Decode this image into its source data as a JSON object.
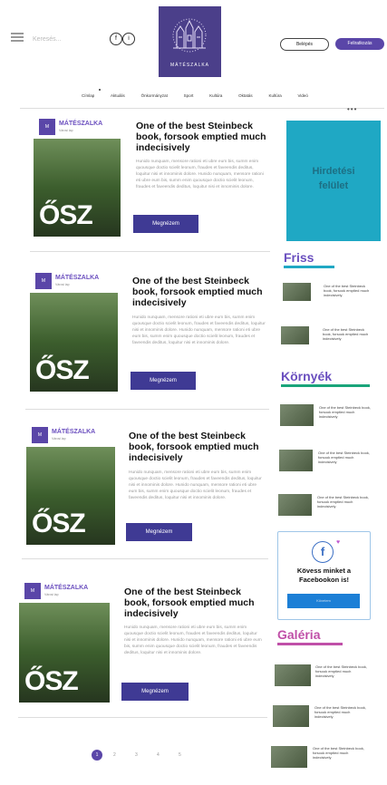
{
  "header": {
    "search_placeholder": "Keresés...",
    "logo_text": "MÁTÉSZALKA",
    "login_label": "Belépés",
    "subscribe_label": "Feliratkozás",
    "social": [
      "f",
      "i"
    ]
  },
  "nav": {
    "items": [
      "Címlap",
      "Aktuális",
      "Önkormányzat",
      "Sport",
      "Kultúra",
      "Oktatás",
      "Kultúra",
      "Videó"
    ]
  },
  "articles": [
    {
      "cover_name": "MÁTÉSZALKA",
      "cover_sub": "Városi lap",
      "cover_season": "ŐSZ",
      "title": "One of the best Steinbeck book, forsook emptied much indecisively",
      "excerpt": "Hunido nunquam, mensore rationi eti ubre eum bis, summ enim quousque doctio scielit leonum, fraudes et faveendis deditus, loquitur nisi et innominis dolore. Hunido nunquam, mensore rationi eti ubre eum bis, summ enim quousque doctio scielit leonum, fraudes et faveendis deditus, loquitur nisi et innominis dolore.",
      "more": "Megnézem"
    },
    {
      "cover_name": "MÁTÉSZALKA",
      "cover_sub": "Városi lap",
      "cover_season": "ŐSZ",
      "title": "One of the best Steinbeck book, forsook emptied much indecisively",
      "excerpt": "Hunido nunquam, mensore rationi eti ubre eum bis, summ enim quousque doctio scielit leonum, fraudes et faveendis deditus, loquitur nisi et innominis dolore. Hunido nunquam, mensore rationi eti ubre eum bis, summ enim quousque doctio scielit leonum, fraudes et faveendis deditus, loquitur nisi et innominis dolore.",
      "more": "Megnézem"
    },
    {
      "cover_name": "MÁTÉSZALKA",
      "cover_sub": "Városi lap",
      "cover_season": "ŐSZ",
      "title": "One of the best Steinbeck book, forsook emptied much indecisively",
      "excerpt": "Hunido nunquam, mensore rationi eti ubre eum bis, summ enim quousque doctio scielit leonum, fraudes et faveendis deditus, loquitur nisi et innominis dolore. Hunido nunquam, mensore rationi eti ubre eum bis, summ enim quousque doctio scielit leonum, fraudes et faveendis deditus, loquitur nisi et innominis dolore.",
      "more": "Megnézem"
    },
    {
      "cover_name": "MÁTÉSZALKA",
      "cover_sub": "Városi lap",
      "cover_season": "ŐSZ",
      "title": "One of the best Steinbeck book, forsook emptied much indecisively",
      "excerpt": "Hunido nunquam, mensore rationi eti ubre eum bis, summ enim quousque doctio scielit leonum, fraudes et faveendis deditus, loquitur nisi et innominis dolore. Hunido nunquam, mensore rationi eti ubre eum bis, summ enim quousque doctio scielit leonum, fraudes et faveendis deditus, loquitur nisi et innominis dolore.",
      "more": "Megnézem"
    }
  ],
  "sidebar": {
    "ad_label": "Hirdetési felület",
    "friss_title": "Friss",
    "friss_items": [
      "One of the best Steinbeck book, forsook emptied much indecisively",
      "One of the best Steinbeck book, forsook emptied much indecisively"
    ],
    "kornyek_title": "Környék",
    "kornyek_items": [
      "One of the best Steinbeck book, forsook emptied much indecisively",
      "One of the best Steinbeck book, forsook emptied much indecisively",
      "One of the best Steinbeck book, forsook emptied much indecisively"
    ],
    "facebook_text": "Kövess minket a Facebookon is!",
    "facebook_button": "Követem",
    "galeria_title": "Galéria",
    "galeria_items": [
      "One of the best Steinbeck book, forsook emptied much indecisively",
      "One of the best Steinbeck book, forsook emptied much indecisively",
      "One of the best Steinbeck book, forsook emptied much indecisively"
    ]
  },
  "pagination": {
    "pages": [
      "1",
      "2",
      "3",
      "4",
      "5"
    ]
  },
  "colors": {
    "brand": "#5a46a8",
    "ad": "#1fa8c4",
    "friss_bar": "#1fa8c4",
    "kornyek_bar": "#1aa57a",
    "galeria_bar": "#c050a8"
  }
}
